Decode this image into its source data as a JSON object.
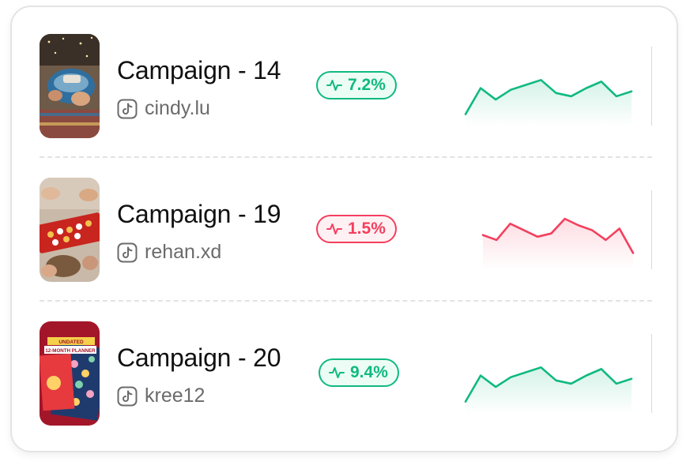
{
  "campaigns": [
    {
      "title": "Campaign - 14",
      "platform_icon": "tiktok-icon",
      "handle": "cindy.lu",
      "change": "7.2%",
      "trend": "up",
      "trend_icon": "pulse-icon",
      "sparkline": [
        6,
        22,
        15,
        21,
        24,
        27,
        19,
        17,
        22,
        26,
        17,
        20
      ],
      "accent": "#10b981",
      "thumbnail": "makeup-bag-photo"
    },
    {
      "title": "Campaign - 19",
      "platform_icon": "tiktok-icon",
      "handle": "rehan.xd",
      "change": "1.5%",
      "trend": "down",
      "trend_icon": "pulse-icon",
      "sparkline": [
        20,
        17,
        27,
        23,
        19,
        21,
        30,
        26,
        23,
        17,
        24,
        9
      ],
      "accent": "#f43f5e",
      "thumbnail": "board-game-photo"
    },
    {
      "title": "Campaign - 20",
      "platform_icon": "tiktok-icon",
      "handle": "kree12",
      "change": "9.4%",
      "trend": "up",
      "trend_icon": "pulse-icon",
      "sparkline": [
        6,
        22,
        15,
        21,
        24,
        27,
        19,
        17,
        22,
        26,
        17,
        20
      ],
      "accent": "#10b981",
      "thumbnail": "planner-photo",
      "thumbnail_text": [
        "UNDATED",
        "12-MONTH PLANNER"
      ]
    }
  ]
}
